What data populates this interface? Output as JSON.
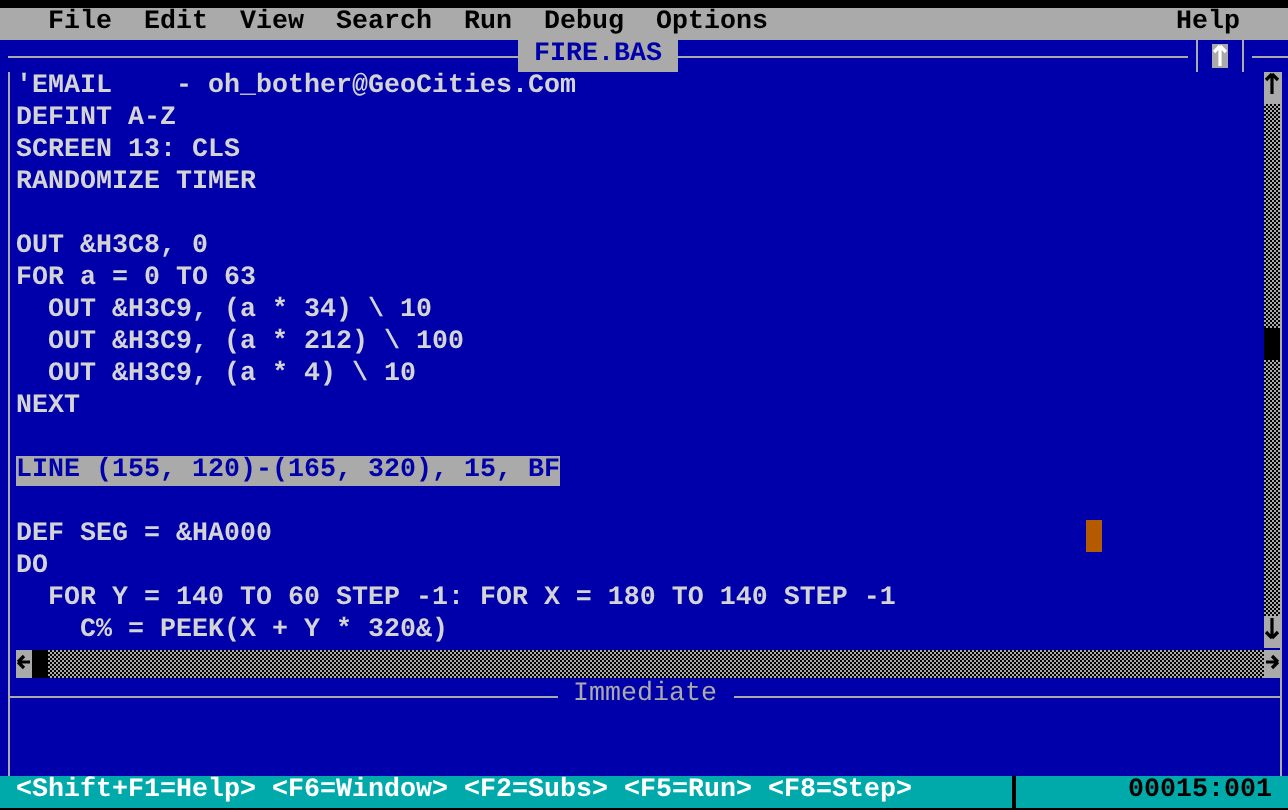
{
  "menu": [
    {
      "label": "File"
    },
    {
      "label": "Edit"
    },
    {
      "label": "View"
    },
    {
      "label": "Search"
    },
    {
      "label": "Run"
    },
    {
      "label": "Debug"
    },
    {
      "label": "Options"
    }
  ],
  "help_menu": {
    "label": "Help"
  },
  "editor": {
    "title": "FIRE.BAS",
    "lines": [
      {
        "kind": "code",
        "text": "'EMAIL    - oh_bother@GeoCities.Com",
        "selected": false
      },
      {
        "kind": "code",
        "text": "DEFINT A-Z",
        "selected": false
      },
      {
        "kind": "code",
        "text": "SCREEN 13: CLS",
        "selected": false
      },
      {
        "kind": "code",
        "text": "RANDOMIZE TIMER",
        "selected": false
      },
      {
        "kind": "blank"
      },
      {
        "kind": "code",
        "text": "OUT &H3C8, 0",
        "selected": false
      },
      {
        "kind": "code",
        "text": "FOR a = 0 TO 63",
        "selected": false
      },
      {
        "kind": "code",
        "text": "  OUT &H3C9, (a * 34) \\ 10",
        "selected": false
      },
      {
        "kind": "code",
        "text": "  OUT &H3C9, (a * 212) \\ 100",
        "selected": false
      },
      {
        "kind": "code",
        "text": "  OUT &H3C9, (a * 4) \\ 10",
        "selected": false
      },
      {
        "kind": "code",
        "text": "NEXT",
        "selected": false
      },
      {
        "kind": "blank"
      },
      {
        "kind": "code",
        "text": "LINE (155, 120)-(165, 320), 15, BF",
        "selected": true
      },
      {
        "kind": "blank"
      },
      {
        "kind": "code",
        "text": "DEF SEG = &HA000",
        "selected": false
      },
      {
        "kind": "code",
        "text": "DO",
        "selected": false
      },
      {
        "kind": "code",
        "text": "  FOR Y = 140 TO 60 STEP -1: FOR X = 180 TO 140 STEP -1",
        "selected": false
      },
      {
        "kind": "code",
        "text": "    C% = PEEK(X + Y * 320&)",
        "selected": false
      }
    ]
  },
  "immediate": {
    "title": "Immediate"
  },
  "status_bar": {
    "hints": [
      "<Shift+F1=Help>",
      "<F6=Window>",
      "<F2=Subs>",
      "<F5=Run>",
      "<F8=Step>"
    ],
    "position": "00015:001"
  }
}
